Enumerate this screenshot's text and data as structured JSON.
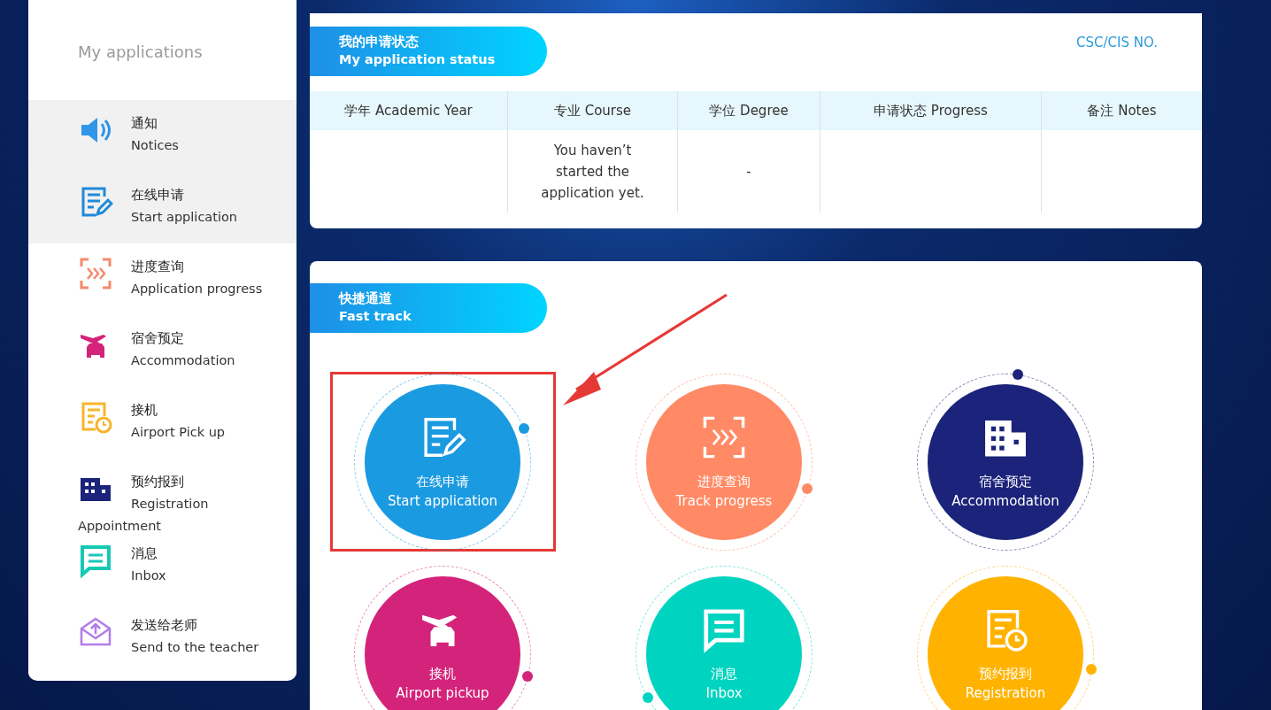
{
  "sidebar": {
    "title": "My applications",
    "items": [
      {
        "zh": "通知",
        "en": "Notices",
        "selected": true
      },
      {
        "zh": "在线申请",
        "en": "Start application",
        "selected": true
      },
      {
        "zh": "进度查询",
        "en": "Application progress",
        "selected": false
      },
      {
        "zh": "宿舍预定",
        "en": "Accommodation",
        "selected": false
      },
      {
        "zh": "接机",
        "en": "Airport Pick up",
        "selected": false
      },
      {
        "zh": "预约报到",
        "en": "Registration Appointment",
        "selected": false
      },
      {
        "zh": "消息",
        "en": "Inbox",
        "selected": false
      },
      {
        "zh": "发送给老师",
        "en": "Send to the teacher",
        "selected": false
      }
    ]
  },
  "status_panel": {
    "title_zh": "我的申请状态",
    "title_en": "My application status",
    "link": "CSC/CIS NO.",
    "table": {
      "columns": [
        "学年 Academic Year",
        "专业 Course",
        "学位 Degree",
        "申请状态 Progress",
        "备注 Notes"
      ],
      "rows": [
        {
          "cells": [
            null,
            "You haven’t started the application yet.",
            "-",
            null,
            null
          ]
        }
      ]
    }
  },
  "fast_track": {
    "title_zh": "快捷通道",
    "title_en": "Fast track",
    "items": [
      {
        "zh": "在线申请",
        "en": "Start application",
        "color": "#1a9ae0",
        "highlighted": true
      },
      {
        "zh": "进度查询",
        "en": "Track progress",
        "color": "#ff8a65",
        "highlighted": false
      },
      {
        "zh": "宿舍预定",
        "en": "Accommodation",
        "color": "#1b237a",
        "highlighted": false
      },
      {
        "zh": "接机",
        "en": "Airport pickup",
        "color": "#d4237a",
        "highlighted": false
      },
      {
        "zh": "消息",
        "en": "Inbox",
        "color": "#00d4c0",
        "highlighted": false
      },
      {
        "zh": "预约报到",
        "en": "Registration",
        "color": "#ffb300",
        "highlighted": false
      }
    ]
  }
}
